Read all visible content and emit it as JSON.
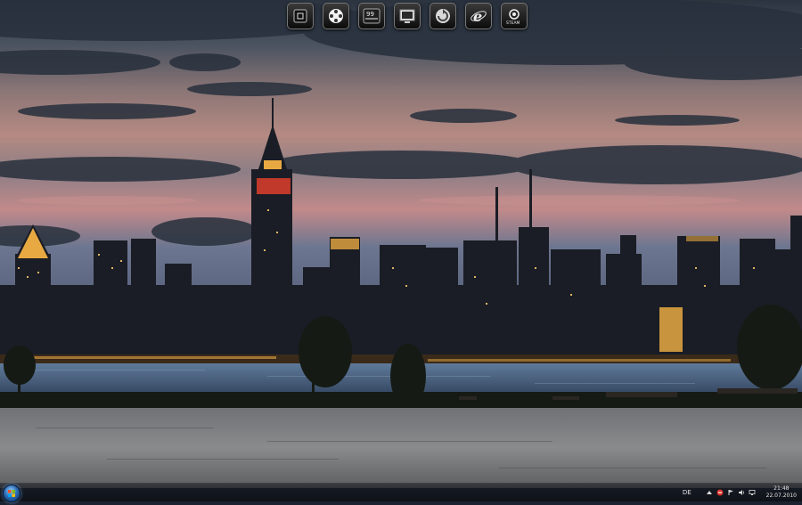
{
  "desktop": {
    "wallpaper": "hdr-city-skyline-at-dusk"
  },
  "dock": {
    "items": [
      {
        "name": "black-app",
        "icon": "square-app-icon"
      },
      {
        "name": "dots-app",
        "icon": "circle-dots-icon"
      },
      {
        "name": "counter-app",
        "icon": "counter-99-icon",
        "label": "99"
      },
      {
        "name": "monitor-app",
        "icon": "monitor-icon"
      },
      {
        "name": "circle-app",
        "icon": "circular-arrow-icon"
      },
      {
        "name": "internet-explorer",
        "icon": "ie-e-icon"
      },
      {
        "name": "steam",
        "icon": "steam-icon",
        "label": "STEAM"
      }
    ]
  },
  "taskbar": {
    "language": "DE",
    "clock": {
      "time": "21:48",
      "date": "22.07.2010"
    }
  }
}
